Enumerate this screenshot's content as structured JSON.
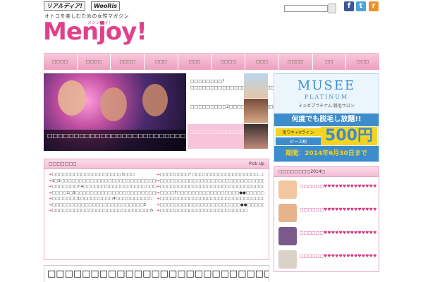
{
  "header": {
    "mini_logos": [
      "リアルディア!",
      "WooRis"
    ],
    "tagline": "オトコを楽しむための女性マガジン",
    "brand": "Menjoy!",
    "brand_sub": "メンジョイ!",
    "search_placeholder": "",
    "social": {
      "facebook": "f",
      "twitter": "t",
      "rss": "r"
    }
  },
  "nav": {
    "items": [
      "□□□□",
      "□□□□",
      "□□□□",
      "□□□",
      "□□□",
      "□□□□",
      "□□□",
      "□□□□",
      "□□",
      "□□□"
    ]
  },
  "featured": {
    "caption": "□□□□□□□□□□□□□□□□□□□□□□□□□□□□□□□□□□□□□□□□□□□□□□□?!",
    "picks": [
      {
        "text": "□□□□□□□□? □□□□□□□□□□□□□□□□□□□□□□□"
      },
      {
        "text": "□□□□□□□□□2□□□□□□□□□□□□□□□□□□□□□□□"
      },
      {
        "text": "□□□□□□□□□□□□□□□□□□□□□□□□□□□□□□□□□□□"
      }
    ]
  },
  "ad": {
    "title": "MUSEE",
    "subtitle": "PLATINUM",
    "kana": "ミュゼプラチナム",
    "kana2": "脱毛サロン",
    "band": "何度でも脱毛し放題!!",
    "pill1": "両ワキ+Vライン",
    "pill2": "ピース割",
    "price": "500円",
    "date": "期間：2014年6月30日まで"
  },
  "ranking": {
    "title": "□□□□□□□",
    "pick_up_label": "Pick Up",
    "left": [
      "□□□□□□□□□□□□□□□□□□□3□□□",
      "1□3□□□□□□□□□□□□□□□□□□□□□□□□□□□□□□□□",
      "□□□□□□□? 4□□□□□□□□□□□□□□□□□□□□□",
      "□□□□2□3□□□□□□□□□□□□□□□□□□□□□□□□□□",
      "□□□□□□□1□□□□□□□□□4□□□□□□□□□□",
      "□□□□□□□□□□□□□□□□□□□□□□□□□3",
      "□□□□□□□□□□□□□□□□□□□□□□□□□□□5"
    ],
    "right": [
      "□□□□□□□□? □□□□□□□□□□□□□□□□□□…□",
      "□□□□□□□□□□□□□□□□□□□□□□□□□□□□□",
      "□□□□□□□□□□□□□□□□□□□□□□□□□□□□□□□□□□□?",
      "□□□□7□□□□□□□□□□□□□□□□□●●□□□□□□",
      "□□□□□□□□□□□□□□□□□□□□□□□□□□□□□□",
      "□□□□□□□□□□□□□□□□□□□□□□●●□□□□□□□□□",
      "□□□□□□□□□□□□□□□□□□□□□□□□"
    ]
  },
  "sidebar": {
    "title": "□□□□□□□□2014□",
    "items": [
      {
        "text": "□□□□□□♥♥♥♥♥♥♥♥♥♥♥♥♥♥♥♥♥♥♥♥♥♥♥♥",
        "color": "#f2c6a0"
      },
      {
        "text": "□□□□□□♥♥♥♥♥♥♥♥♥♥♥♥♥♥♥♥♥♥♥♥♥♥♥♥",
        "color": "#e6b38c"
      },
      {
        "text": "□□□□□□♥♥♥♥♥♥♥♥♥♥♥♥♥♥♥♥♥♥♥♥♥♥♥♥",
        "color": "#7a5a8a"
      },
      {
        "text": "□□□□□□♥♥♥♥♥♥♥♥♥♥♥♥♥♥♥♥♥♥♥♥♥♥♥♥",
        "color": "#d9d0c6"
      }
    ]
  },
  "headline": "□□□□□□□□□□□□□□□□□□□□□□□□□□□□□4□",
  "colors": {
    "brand": "#e0418a",
    "nav_pink": "#ee9fc0",
    "ad_blue": "#3d8ccb",
    "ad_yellow": "#f5d31f"
  }
}
